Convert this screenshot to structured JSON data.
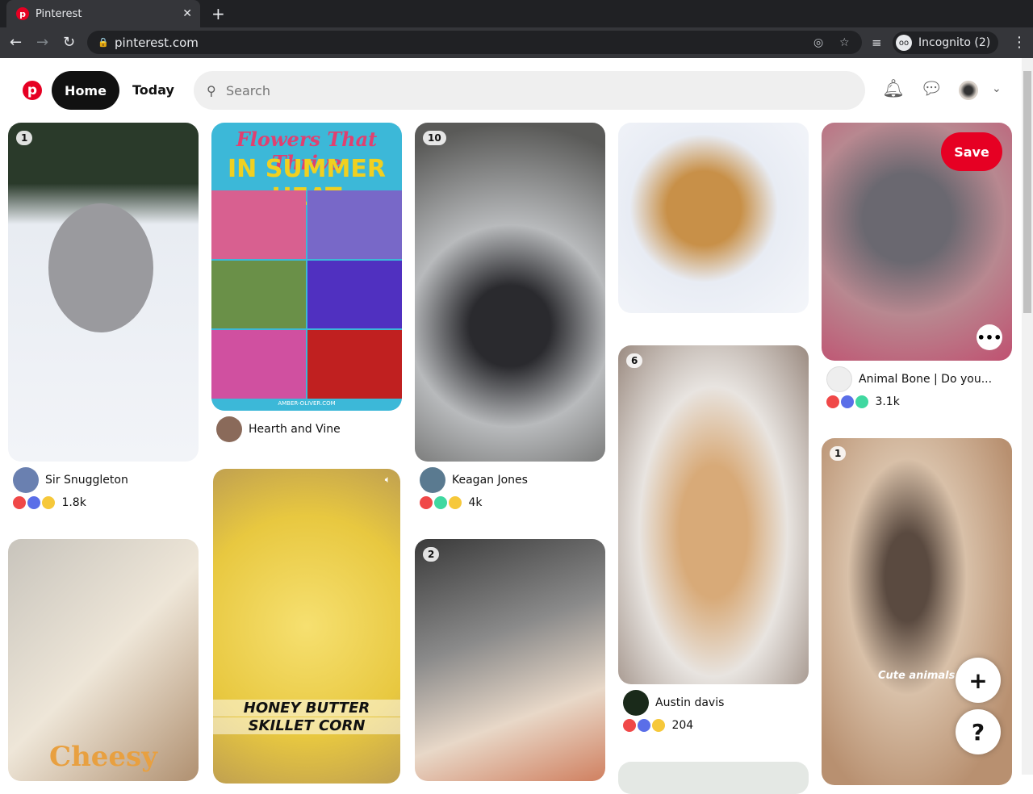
{
  "browser": {
    "tab_title": "Pinterest",
    "url": "pinterest.com",
    "incognito_label": "Incognito (2)"
  },
  "header": {
    "home": "Home",
    "today": "Today",
    "search_placeholder": "Search"
  },
  "pins": [
    {
      "badge": "1",
      "author": "Sir Snuggleton",
      "count": "1.8k"
    },
    {
      "overlay_title_1": "Flowers That Thrive",
      "overlay_title_2": "IN SUMMER HEAT",
      "watermark": "AMBER-OLIVER.COM",
      "author": "Hearth and Vine"
    },
    {
      "badge": "10",
      "author": "Keagan Jones",
      "count": "4k"
    },
    {},
    {
      "save": "Save",
      "author": "Animal Bone | Do you...",
      "count": "3.1k"
    },
    {
      "overlay": "Cheesy"
    },
    {
      "overlay_1": "HONEY BUTTER",
      "overlay_2": "SKILLET CORN"
    },
    {
      "badge": "2"
    },
    {
      "badge": "6",
      "author": "Austin davis",
      "count": "204"
    },
    {
      "badge": "1",
      "overlay": "Cute animals"
    }
  ],
  "fab": {
    "add": "+",
    "help": "?"
  }
}
